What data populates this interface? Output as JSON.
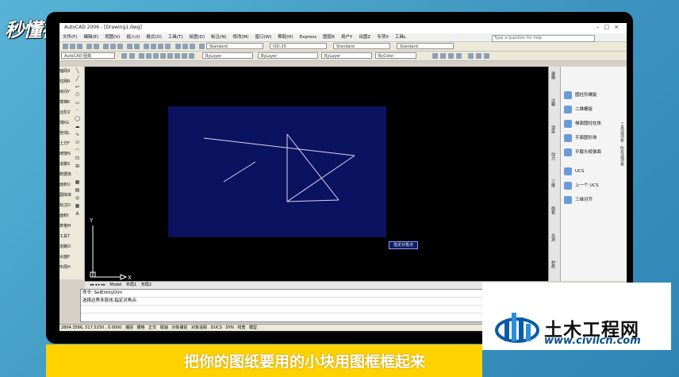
{
  "watermark": "秒懂视频",
  "app": {
    "title": "AutoCAD 2006 - [Drawing1.dwg]",
    "menu": [
      "文件(F)",
      "编辑(E)",
      "视图(V)",
      "插入(I)",
      "格式(O)",
      "工具(T)",
      "绘图(D)",
      "标注(N)",
      "修改(M)",
      "窗口(W)",
      "帮助(H)",
      "Express",
      "图层R",
      "用户Y",
      "出图Z",
      "专项X",
      "工具L"
    ],
    "search_placeholder": "Type a question for help",
    "toolbar2": {
      "text_style": "Standard",
      "dim_style": "ISO-25",
      "table_style": "Standard",
      "extra_style": "Standard"
    },
    "toolbar3": {
      "workspace": "AutoCAD 经典",
      "layer": "ByLayer",
      "linetype": "ByLayer",
      "lineweight": "ByLayer",
      "color": "ByColor"
    },
    "left_toolbar": [
      "轴网X",
      "柱网R",
      "房间Y",
      "楼梯K",
      "台阶Z",
      "墙KG",
      "管线L",
      "土方F",
      "坡度N",
      "道路S",
      "数据库",
      "面积U",
      "图库库",
      "标注D",
      "面积I",
      "表格M",
      "工具T",
      "道路O",
      "水面P",
      "布局H"
    ],
    "tooltip": "指定对角点",
    "model_tabs": [
      "Model",
      "布局1",
      "布局2"
    ],
    "command_lines": [
      "命令: SelEntityDim",
      "选择边界多段线,指定对角点:"
    ],
    "status": {
      "coords": "2804.3586, 517.5250 , 0.0000",
      "toggles": [
        "捕捉",
        "栅格",
        "正交",
        "极轴",
        "对象捕捉",
        "对象追踪",
        "DUCS",
        "DYN",
        "线宽",
        "模型"
      ]
    },
    "palette": {
      "tabs": [
        "建模",
        "注释",
        "渲染",
        "动力",
        "三维",
        "面板",
        "光源",
        "材质"
      ],
      "items": [
        "圆柱形螺旋",
        "二维螺旋",
        "梯面圆柱柱体",
        "平面圆形体",
        "平截头棱锥面",
        "UCS",
        "上一个 UCS",
        "三维对齐"
      ],
      "side_title": "工具选项板 - 所有选项板"
    }
  },
  "logo": {
    "name": "土木工程网",
    "url": "www.civilcn.com"
  },
  "subtitle": "把你的图纸要用的小块用图框框起来"
}
